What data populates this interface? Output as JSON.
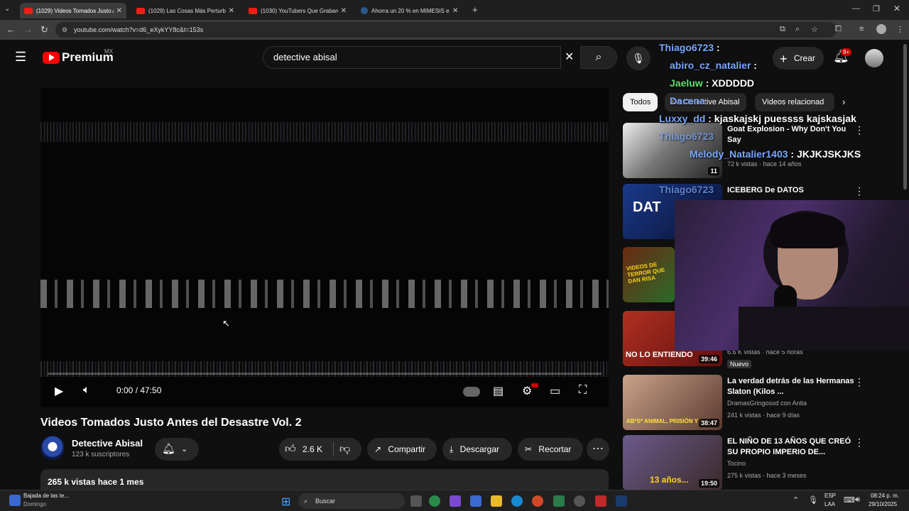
{
  "browser": {
    "tabs": [
      {
        "title": "(1029) Videos Tomados Justo A",
        "active": true
      },
      {
        "title": "(1029) Las Cosas Más Perturba",
        "active": false
      },
      {
        "title": "(1030) YouTubers Que Grabaro",
        "active": false
      },
      {
        "title": "Ahorra un 20 % en MIMESIS en",
        "active": false
      }
    ],
    "url": "youtube.com/watch?v=d6_eXykYY8c&t=153s"
  },
  "header": {
    "logo": "Premium",
    "region": "MX",
    "search_value": "detective abisal",
    "create_label": "Crear",
    "notif_count": "9+"
  },
  "player": {
    "time": "0:00 / 47:50"
  },
  "video": {
    "title": "Videos Tomados Justo Antes del Desastre Vol. 2",
    "channel": "Detective Abisal",
    "subs": "123 k suscriptores",
    "likes": "2.6 K",
    "share": "Compartir",
    "download": "Descargar",
    "clip": "Recortar",
    "views": "265 k vistas  hace 1 mes"
  },
  "chips": [
    "Todos",
    "De Detective Abisal",
    "Videos relacionad"
  ],
  "recommendations": [
    {
      "title": "Goat Explosion - Why Don't You Say",
      "channel": "",
      "meta": "72 k vistas · hace 14 años",
      "duration": "11"
    },
    {
      "title": "ICEBERG De DATOS",
      "channel": "",
      "meta": "",
      "duration": ""
    },
    {
      "title": "",
      "channel": "",
      "meta": "",
      "duration": ""
    },
    {
      "title": "",
      "channel": "",
      "meta": "6.6 K vistas · hace 5 horas",
      "badge": "Nuevo",
      "duration": "39:46"
    },
    {
      "title": "La verdad detrás de las Hermanas Slaton (Kilos ...",
      "channel": "DramasGringosxd con Anita",
      "meta": "241 k vistas · hace 9 días",
      "duration": "38:47"
    },
    {
      "title": "EL NIÑO DE 13 AÑOS QUE CREÓ SU PROPIO IMPERIO DE...",
      "channel": "Tocino",
      "meta": "275 k vistas · hace 3 meses",
      "duration": "19:50"
    }
  ],
  "chat": [
    {
      "user": "Thiago6723",
      "msg": ":"
    },
    {
      "user": "abiro_cz_natalier",
      "msg": ":"
    },
    {
      "user": "Jaeluw",
      "msg": ": XDDDDD"
    },
    {
      "user": "Dacena",
      "msg": ""
    },
    {
      "user": "Luxxy_dd",
      "msg": ": kjaskajskj puessss kajskasjak"
    },
    {
      "user": "Thiago6723",
      "msg": ""
    },
    {
      "user": "Melody_Natalier1403",
      "msg": ": JKJKJSKJKS"
    },
    {
      "user": "Thiago6723",
      "msg": ""
    }
  ],
  "thumb_texts": {
    "t2": "DAT",
    "t3": "VIDEOS DE TERROR QUE DAN RISA",
    "t4": "NO LO ENTIENDO",
    "t5": "AB*S* ANIMAL, PRISIÓN Y I",
    "t6": "13 años..."
  },
  "taskbar": {
    "notif_title": "Bajada de las te...",
    "notif_sub": "Domingo",
    "search": "Buscar",
    "lang": "ESP",
    "lang2": "LAA",
    "time": "08:24 p. m.",
    "date": "29/10/2025"
  }
}
